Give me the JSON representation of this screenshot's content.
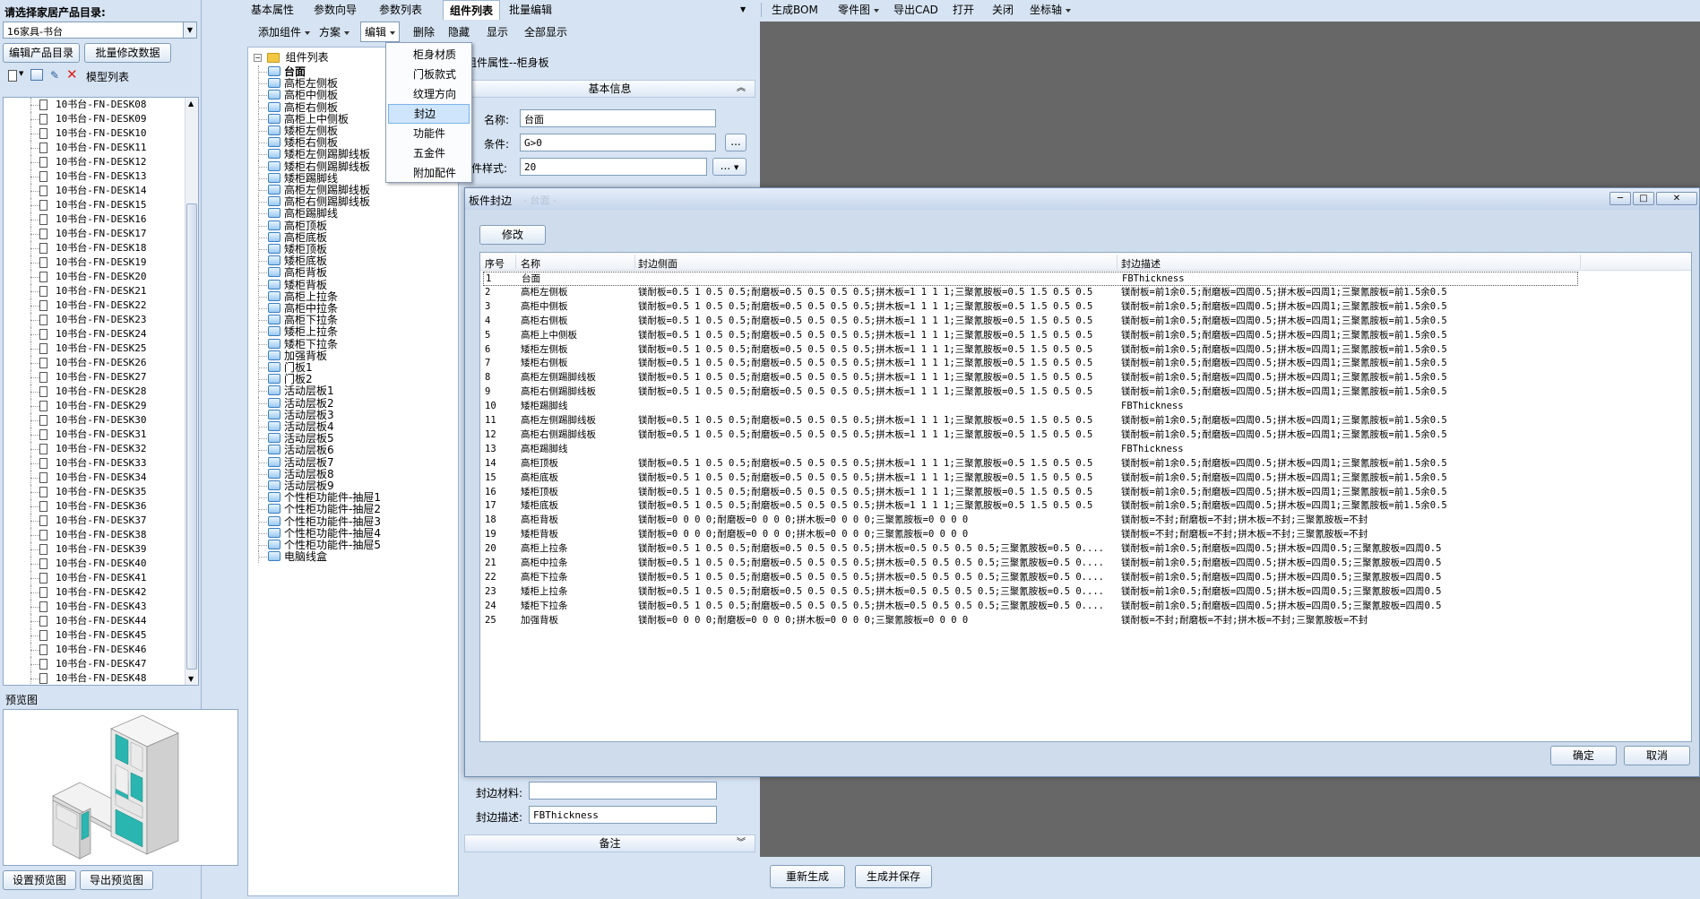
{
  "left": {
    "catalog_label": "请选择家居产品目录:",
    "catalog_value": "16家具-书台",
    "edit_catalog_btn": "编辑产品目录",
    "batch_edit_btn": "批量修改数据",
    "model_list_label": "模型列表",
    "models": [
      "10书台-FN-DESK08",
      "10书台-FN-DESK09",
      "10书台-FN-DESK10",
      "10书台-FN-DESK11",
      "10书台-FN-DESK12",
      "10书台-FN-DESK13",
      "10书台-FN-DESK14",
      "10书台-FN-DESK15",
      "10书台-FN-DESK16",
      "10书台-FN-DESK17",
      "10书台-FN-DESK18",
      "10书台-FN-DESK19",
      "10书台-FN-DESK20",
      "10书台-FN-DESK21",
      "10书台-FN-DESK22",
      "10书台-FN-DESK23",
      "10书台-FN-DESK24",
      "10书台-FN-DESK25",
      "10书台-FN-DESK26",
      "10书台-FN-DESK27",
      "10书台-FN-DESK28",
      "10书台-FN-DESK29",
      "10书台-FN-DESK30",
      "10书台-FN-DESK31",
      "10书台-FN-DESK32",
      "10书台-FN-DESK33",
      "10书台-FN-DESK34",
      "10书台-FN-DESK35",
      "10书台-FN-DESK36",
      "10书台-FN-DESK37",
      "10书台-FN-DESK38",
      "10书台-FN-DESK39",
      "10书台-FN-DESK40",
      "10书台-FN-DESK41",
      "10书台-FN-DESK42",
      "10书台-FN-DESK43",
      "10书台-FN-DESK44",
      "10书台-FN-DESK45",
      "10书台-FN-DESK46",
      "10书台-FN-DESK47",
      "10书台-FN-DESK48"
    ],
    "preview_label": "预览图",
    "set_preview_btn": "设置预览图",
    "export_preview_btn": "导出预览图"
  },
  "tabs": [
    "基本属性",
    "参数向导",
    "参数列表",
    "组件列表",
    "批量编辑"
  ],
  "active_tab": "组件列表",
  "top_toolbar": [
    "生成BOM",
    "零件图",
    "导出CAD",
    "打开",
    "关闭",
    "坐标轴"
  ],
  "component_toolbar": {
    "add": "添加组件",
    "scheme": "方案",
    "edit": "编辑",
    "delete": "删除",
    "hide": "隐藏",
    "show": "显示",
    "show_all": "全部显示"
  },
  "edit_menu": [
    "柜身材质",
    "门板款式",
    "纹理方向",
    "封边",
    "功能件",
    "五金件",
    "附加配件"
  ],
  "tree": {
    "root": "组件列表",
    "items": [
      "台面",
      "高柜左侧板",
      "高柜中侧板",
      "高柜右侧板",
      "高柜上中侧板",
      "矮柜左侧板",
      "矮柜右侧板",
      "矮柜左侧踢脚线板",
      "矮柜右侧踢脚线板",
      "矮柜踢脚线",
      "高柜左侧踢脚线板",
      "高柜右侧踢脚线板",
      "高柜踢脚线",
      "高柜顶板",
      "高柜底板",
      "矮柜顶板",
      "矮柜底板",
      "高柜背板",
      "矮柜背板",
      "高柜上拉条",
      "高柜中拉条",
      "高柜下拉条",
      "矮柜上拉条",
      "矮柜下拉条",
      "加强背板",
      "门板1",
      "门板2",
      "活动层板1",
      "活动层板2",
      "活动层板3",
      "活动层板4",
      "活动层板5",
      "活动层板6",
      "活动层板7",
      "活动层板8",
      "活动层板9",
      "个性柜功能件-抽屉1",
      "个性柜功能件-抽屉2",
      "个性柜功能件-抽屉3",
      "个性柜功能件-抽屉4",
      "个性柜功能件-抽屉5",
      "电脑线盒"
    ]
  },
  "props": {
    "title": "组件属性--柜身板",
    "section_basic": "基本信息",
    "name_label": "名称:",
    "name_value": "台面",
    "cond_label": "条件:",
    "cond_value": "G>0",
    "style_label": "板件样式:",
    "style_value": "20",
    "ellipsis": "...",
    "edge_material_label": "封边材料:",
    "edge_material_value": "",
    "edge_desc_label": "封边描述:",
    "edge_desc_value": "FBThickness",
    "section_notes": "备注"
  },
  "bottom_buttons": {
    "regen": "重新生成",
    "gen_save": "生成并保存"
  },
  "dialog": {
    "title": "板件封边",
    "title_suffix": "- 台面 -",
    "modify_btn": "修改",
    "ok_btn": "确定",
    "cancel_btn": "取消",
    "columns": [
      "序号",
      "名称",
      "封边侧面",
      "封边描述"
    ],
    "rows": [
      [
        "1",
        "台面",
        "",
        "FBThickness"
      ],
      [
        "2",
        "高柜左侧板",
        "镁耐板=0.5 1 0.5 0.5;耐磨板=0.5 0.5 0.5 0.5;拼木板=1 1 1 1;三聚氰胺板=0.5 1.5 0.5 0.5",
        "镁耐板=前1余0.5;耐磨板=四周0.5;拼木板=四周1;三聚氰胺板=前1.5余0.5"
      ],
      [
        "3",
        "高柜中侧板",
        "镁耐板=0.5 1 0.5 0.5;耐磨板=0.5 0.5 0.5 0.5;拼木板=1 1 1 1;三聚氰胺板=0.5 1.5 0.5 0.5",
        "镁耐板=前1余0.5;耐磨板=四周0.5;拼木板=四周1;三聚氰胺板=前1.5余0.5"
      ],
      [
        "4",
        "高柜右侧板",
        "镁耐板=0.5 1 0.5 0.5;耐磨板=0.5 0.5 0.5 0.5;拼木板=1 1 1 1;三聚氰胺板=0.5 1.5 0.5 0.5",
        "镁耐板=前1余0.5;耐磨板=四周0.5;拼木板=四周1;三聚氰胺板=前1.5余0.5"
      ],
      [
        "5",
        "高柜上中侧板",
        "镁耐板=0.5 1 0.5 0.5;耐磨板=0.5 0.5 0.5 0.5;拼木板=1 1 1 1;三聚氰胺板=0.5 1.5 0.5 0.5",
        "镁耐板=前1余0.5;耐磨板=四周0.5;拼木板=四周1;三聚氰胺板=前1.5余0.5"
      ],
      [
        "6",
        "矮柜左侧板",
        "镁耐板=0.5 1 0.5 0.5;耐磨板=0.5 0.5 0.5 0.5;拼木板=1 1 1 1;三聚氰胺板=0.5 1.5 0.5 0.5",
        "镁耐板=前1余0.5;耐磨板=四周0.5;拼木板=四周1;三聚氰胺板=前1.5余0.5"
      ],
      [
        "7",
        "矮柜右侧板",
        "镁耐板=0.5 1 0.5 0.5;耐磨板=0.5 0.5 0.5 0.5;拼木板=1 1 1 1;三聚氰胺板=0.5 1.5 0.5 0.5",
        "镁耐板=前1余0.5;耐磨板=四周0.5;拼木板=四周1;三聚氰胺板=前1.5余0.5"
      ],
      [
        "8",
        "高柜左侧踢脚线板",
        "镁耐板=0.5 1 0.5 0.5;耐磨板=0.5 0.5 0.5 0.5;拼木板=1 1 1 1;三聚氰胺板=0.5 1.5 0.5 0.5",
        "镁耐板=前1余0.5;耐磨板=四周0.5;拼木板=四周1;三聚氰胺板=前1.5余0.5"
      ],
      [
        "9",
        "高柜右侧踢脚线板",
        "镁耐板=0.5 1 0.5 0.5;耐磨板=0.5 0.5 0.5 0.5;拼木板=1 1 1 1;三聚氰胺板=0.5 1.5 0.5 0.5",
        "镁耐板=前1余0.5;耐磨板=四周0.5;拼木板=四周1;三聚氰胺板=前1.5余0.5"
      ],
      [
        "10",
        "矮柜踢脚线",
        "",
        "FBThickness"
      ],
      [
        "11",
        "高柜左侧踢脚线板",
        "镁耐板=0.5 1 0.5 0.5;耐磨板=0.5 0.5 0.5 0.5;拼木板=1 1 1 1;三聚氰胺板=0.5 1.5 0.5 0.5",
        "镁耐板=前1余0.5;耐磨板=四周0.5;拼木板=四周1;三聚氰胺板=前1.5余0.5"
      ],
      [
        "12",
        "高柜右侧踢脚线板",
        "镁耐板=0.5 1 0.5 0.5;耐磨板=0.5 0.5 0.5 0.5;拼木板=1 1 1 1;三聚氰胺板=0.5 1.5 0.5 0.5",
        "镁耐板=前1余0.5;耐磨板=四周0.5;拼木板=四周1;三聚氰胺板=前1.5余0.5"
      ],
      [
        "13",
        "高柜踢脚线",
        "",
        "FBThickness"
      ],
      [
        "14",
        "高柜顶板",
        "镁耐板=0.5 1 0.5 0.5;耐磨板=0.5 0.5 0.5 0.5;拼木板=1 1 1 1;三聚氰胺板=0.5 1.5 0.5 0.5",
        "镁耐板=前1余0.5;耐磨板=四周0.5;拼木板=四周1;三聚氰胺板=前1.5余0.5"
      ],
      [
        "15",
        "高柜底板",
        "镁耐板=0.5 1 0.5 0.5;耐磨板=0.5 0.5 0.5 0.5;拼木板=1 1 1 1;三聚氰胺板=0.5 1.5 0.5 0.5",
        "镁耐板=前1余0.5;耐磨板=四周0.5;拼木板=四周1;三聚氰胺板=前1.5余0.5"
      ],
      [
        "16",
        "矮柜顶板",
        "镁耐板=0.5 1 0.5 0.5;耐磨板=0.5 0.5 0.5 0.5;拼木板=1 1 1 1;三聚氰胺板=0.5 1.5 0.5 0.5",
        "镁耐板=前1余0.5;耐磨板=四周0.5;拼木板=四周1;三聚氰胺板=前1.5余0.5"
      ],
      [
        "17",
        "矮柜底板",
        "镁耐板=0.5 1 0.5 0.5;耐磨板=0.5 0.5 0.5 0.5;拼木板=1 1 1 1;三聚氰胺板=0.5 1.5 0.5 0.5",
        "镁耐板=前1余0.5;耐磨板=四周0.5;拼木板=四周1;三聚氰胺板=前1.5余0.5"
      ],
      [
        "18",
        "高柜背板",
        "镁耐板=0 0 0 0;耐磨板=0 0 0 0;拼木板=0 0 0 0;三聚氰胺板=0 0 0 0",
        "镁耐板=不封;耐磨板=不封;拼木板=不封;三聚氰胺板=不封"
      ],
      [
        "19",
        "矮柜背板",
        "镁耐板=0 0 0 0;耐磨板=0 0 0 0;拼木板=0 0 0 0;三聚氰胺板=0 0 0 0",
        "镁耐板=不封;耐磨板=不封;拼木板=不封;三聚氰胺板=不封"
      ],
      [
        "20",
        "高柜上拉条",
        "镁耐板=0.5 1 0.5 0.5;耐磨板=0.5 0.5 0.5 0.5;拼木板=0.5 0.5 0.5 0.5;三聚氰胺板=0.5 0....",
        "镁耐板=前1余0.5;耐磨板=四周0.5;拼木板=四周0.5;三聚氰胺板=四周0.5"
      ],
      [
        "21",
        "高柜中拉条",
        "镁耐板=0.5 1 0.5 0.5;耐磨板=0.5 0.5 0.5 0.5;拼木板=0.5 0.5 0.5 0.5;三聚氰胺板=0.5 0....",
        "镁耐板=前1余0.5;耐磨板=四周0.5;拼木板=四周0.5;三聚氰胺板=四周0.5"
      ],
      [
        "22",
        "高柜下拉条",
        "镁耐板=0.5 1 0.5 0.5;耐磨板=0.5 0.5 0.5 0.5;拼木板=0.5 0.5 0.5 0.5;三聚氰胺板=0.5 0....",
        "镁耐板=前1余0.5;耐磨板=四周0.5;拼木板=四周0.5;三聚氰胺板=四周0.5"
      ],
      [
        "23",
        "矮柜上拉条",
        "镁耐板=0.5 1 0.5 0.5;耐磨板=0.5 0.5 0.5 0.5;拼木板=0.5 0.5 0.5 0.5;三聚氰胺板=0.5 0....",
        "镁耐板=前1余0.5;耐磨板=四周0.5;拼木板=四周0.5;三聚氰胺板=四周0.5"
      ],
      [
        "24",
        "矮柜下拉条",
        "镁耐板=0.5 1 0.5 0.5;耐磨板=0.5 0.5 0.5 0.5;拼木板=0.5 0.5 0.5 0.5;三聚氰胺板=0.5 0....",
        "镁耐板=前1余0.5;耐磨板=四周0.5;拼木板=四周0.5;三聚氰胺板=四周0.5"
      ],
      [
        "25",
        "加强背板",
        "镁耐板=0 0 0 0;耐磨板=0 0 0 0;拼木板=0 0 0 0;三聚氰胺板=0 0 0 0",
        "镁耐板=不封;耐磨板=不封;拼木板=不封;三聚氰胺板=不封"
      ]
    ]
  },
  "colors": {
    "accent": "#3399ff",
    "panel": "#d6e3f2",
    "viewport": "#676767",
    "cabinet_teal": "#2ab5b0"
  }
}
